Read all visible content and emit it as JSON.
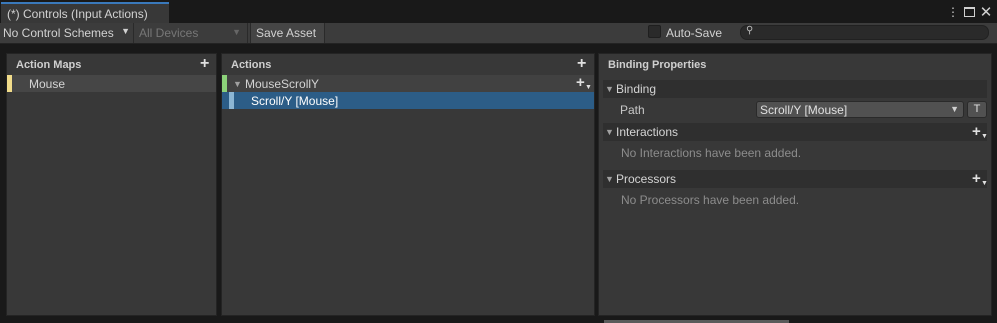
{
  "window": {
    "tab_title": "(*) Controls (Input Actions)",
    "menu_icon": "kebab-menu-icon",
    "maximize_icon": "maximize-icon",
    "close_icon": "close-icon"
  },
  "toolbar": {
    "control_schemes": "No Control Schemes",
    "devices": "All Devices",
    "save_label": "Save Asset",
    "autosave_label": "Auto-Save",
    "autosave_checked": false,
    "search_value": ""
  },
  "action_maps": {
    "title": "Action Maps",
    "items": [
      {
        "label": "Mouse",
        "color": "#f1dc8a"
      }
    ]
  },
  "actions": {
    "title": "Actions",
    "items": [
      {
        "label": "MouseScrollY",
        "color": "#8cd27a",
        "expanded": true
      },
      {
        "label": "Scroll/Y [Mouse]",
        "color": "#8cb6d4",
        "selected": true
      }
    ]
  },
  "properties": {
    "title": "Binding Properties",
    "binding": {
      "header": "Binding",
      "path_label": "Path",
      "path_value": "Scroll/Y [Mouse]",
      "t_label": "T"
    },
    "interactions": {
      "header": "Interactions",
      "empty": "No Interactions have been added."
    },
    "processors": {
      "header": "Processors",
      "empty": "No Processors have been added."
    }
  },
  "colors": {
    "accent": "#3a79bb",
    "selection": "#2c5d87",
    "panel": "#383838"
  }
}
